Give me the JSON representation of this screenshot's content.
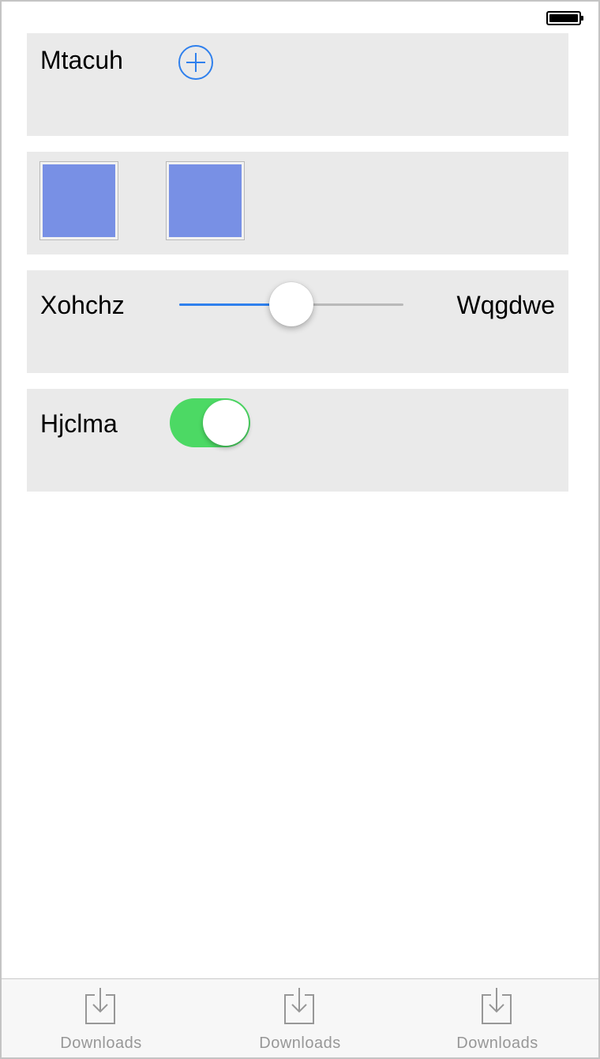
{
  "status_bar": {
    "battery_icon": "battery-icon"
  },
  "colors": {
    "accent_blue": "#2f80ed",
    "card_bg": "#eaeaea",
    "swatch_fill": "#7890e5",
    "switch_on": "#4cd964",
    "tab_inactive": "#979797"
  },
  "rows": {
    "add_row": {
      "label": "Mtacuh",
      "icon": "plus-circle-icon"
    },
    "swatch_row": {
      "swatches": [
        "#7890e5",
        "#7890e5"
      ]
    },
    "slider_row": {
      "min_label": "Xohchz",
      "max_label": "Wqgdwe",
      "value_fraction": 0.5
    },
    "switch_row": {
      "label": "Hjclma",
      "on": true
    }
  },
  "tab_bar": {
    "tabs": [
      {
        "label": "Downloads",
        "icon": "download-icon"
      },
      {
        "label": "Downloads",
        "icon": "download-icon"
      },
      {
        "label": "Downloads",
        "icon": "download-icon"
      }
    ]
  }
}
